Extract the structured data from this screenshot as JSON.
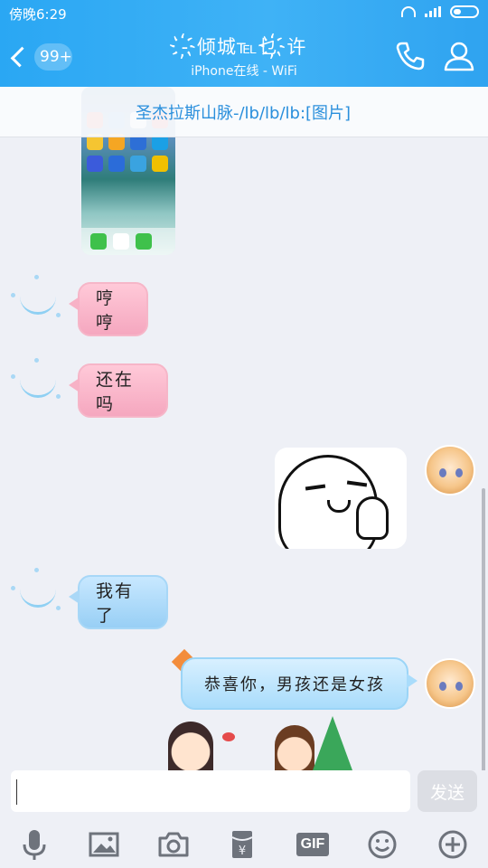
{
  "status": {
    "time": "傍晚6:29"
  },
  "header": {
    "back_badge": "99+",
    "title": "-҉倾城℡乜҉许",
    "subtitle": "iPhone在线 - WiFi"
  },
  "banner": {
    "text": "圣杰拉斯山脉-/lb/lb/lb:[图片]"
  },
  "messages": [
    {
      "side": "left",
      "style": "pink",
      "text": "哼哼"
    },
    {
      "side": "left",
      "style": "pink",
      "text": "还在吗"
    },
    {
      "side": "right",
      "type": "sticker"
    },
    {
      "side": "left",
      "style": "blue",
      "text": "我有了"
    },
    {
      "side": "right",
      "style": "blue",
      "text": "恭喜你，男孩还是女孩"
    }
  ],
  "input": {
    "value": "",
    "send_label": "发送"
  },
  "toolbar": {
    "items": [
      "mic-icon",
      "image-icon",
      "camera-icon",
      "red-packet-icon",
      "gif-icon",
      "emoji-icon",
      "plus-icon"
    ],
    "gif_label": "GIF"
  },
  "colors": {
    "header": "#34aef5",
    "accent": "#2a8fdc"
  }
}
